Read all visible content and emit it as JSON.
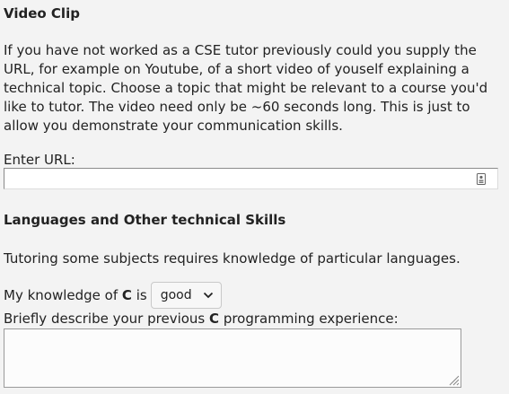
{
  "video_clip": {
    "heading": "Video Clip",
    "paragraph": "If you have not worked as a CSE tutor previously could you supply the URL, for example on Youtube, of a short video of youself explaining a technical topic. Choose a topic that might be relevant to a course you'd like to tutor. The video need only be ~60 seconds long. This is just to allow you demonstrate your communication skills.",
    "url_label": "Enter URL:",
    "url_value": "",
    "url_field_icon": "contact-card-icon"
  },
  "languages": {
    "heading": "Languages and Other technical Skills",
    "intro": "Tutoring some subjects requires knowledge of particular languages.",
    "knowledge_prefix": "My knowledge of",
    "language": "C",
    "knowledge_is": "is",
    "knowledge_value": "good",
    "describe_prefix": "Briefly describe your previous",
    "describe_language": "C",
    "describe_suffix": "programming experience:",
    "experience_text": ""
  },
  "colors": {
    "background": "#f3f3f3",
    "text": "#222222",
    "input_background": "#ffffff"
  }
}
